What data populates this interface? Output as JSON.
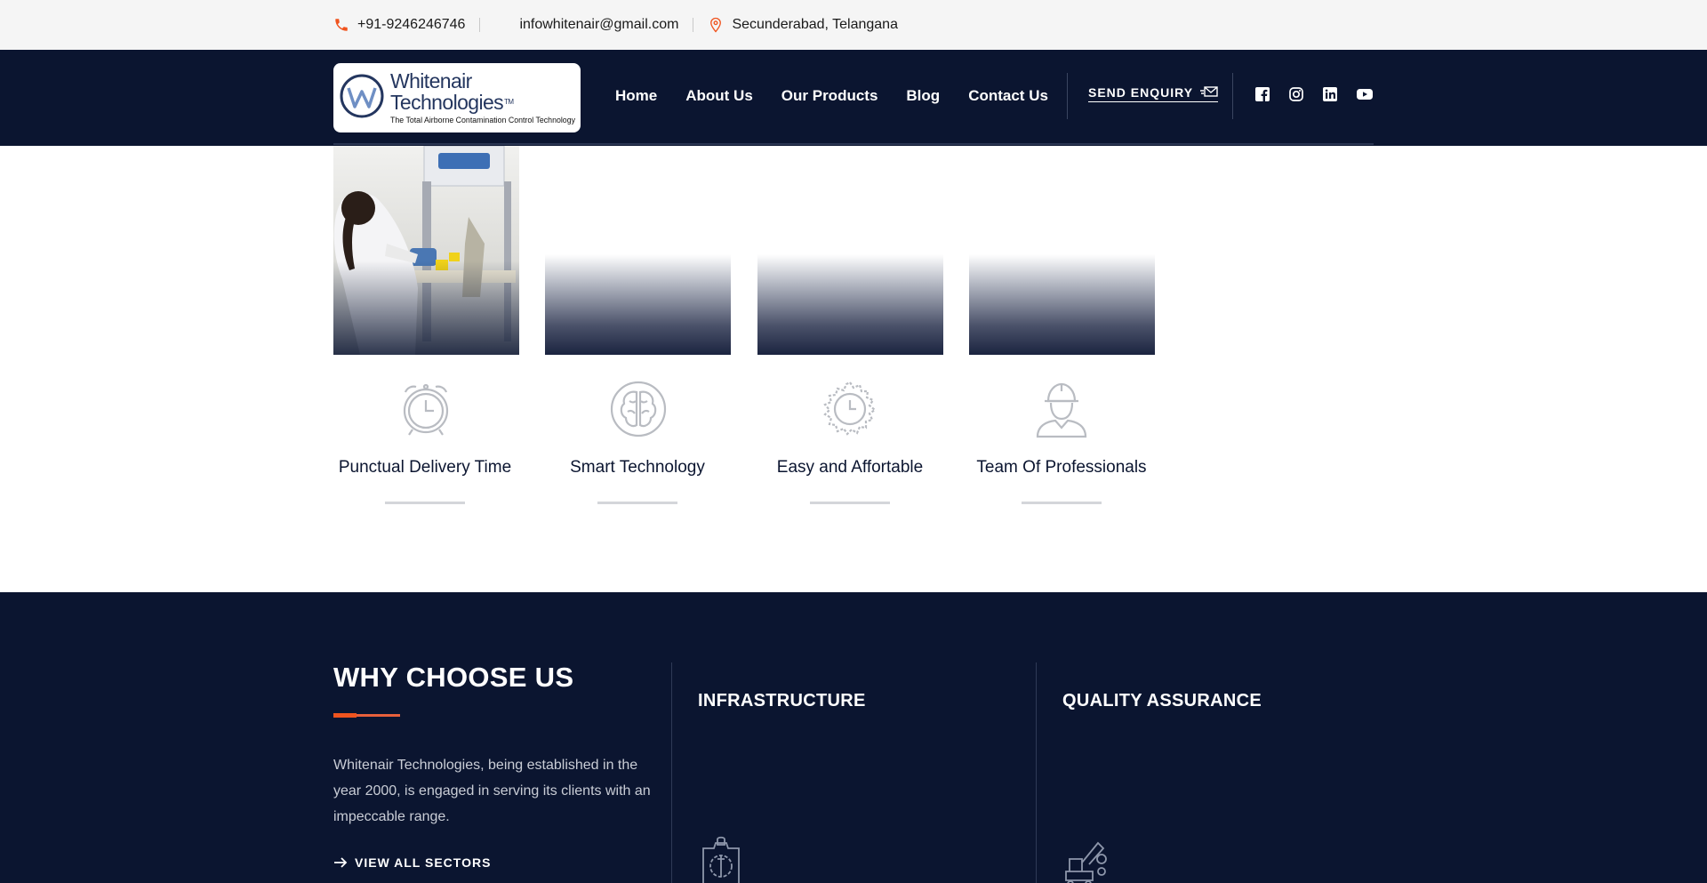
{
  "topbar": {
    "phone": "+91-9246246746",
    "email": "infowhitenair@gmail.com",
    "location": "Secunderabad, Telangana"
  },
  "header": {
    "logo_name": "Whitenair Technologies",
    "logo_tm": "TM",
    "logo_tagline": "The Total Airborne Contamination Control Technology",
    "nav": [
      "Home",
      "About Us",
      "Our Products",
      "Blog",
      "Contact Us"
    ],
    "enquiry": "SEND ENQUIRY"
  },
  "features": [
    {
      "title": "Punctual Delivery Time",
      "icon": "alarm-clock-icon"
    },
    {
      "title": "Smart Technology",
      "icon": "brain-icon"
    },
    {
      "title": "Easy and Affortable",
      "icon": "gear-clock-icon"
    },
    {
      "title": "Team Of Professionals",
      "icon": "engineer-icon"
    }
  ],
  "why": {
    "title": "WHY CHOOSE US",
    "text": "Whitenair Technologies, being established in the year 2000, is engaged in serving its clients with an impeccable range.",
    "link": "VIEW ALL SECTORS",
    "columns": [
      {
        "title": "INFRASTRUCTURE",
        "icon": "wrench-gear-icon"
      },
      {
        "title": "QUALITY ASSURANCE",
        "icon": "excavator-icon"
      }
    ]
  },
  "colors": {
    "navy": "#0b1530",
    "accent": "#f0541f",
    "topbar": "#f5f5f5"
  }
}
